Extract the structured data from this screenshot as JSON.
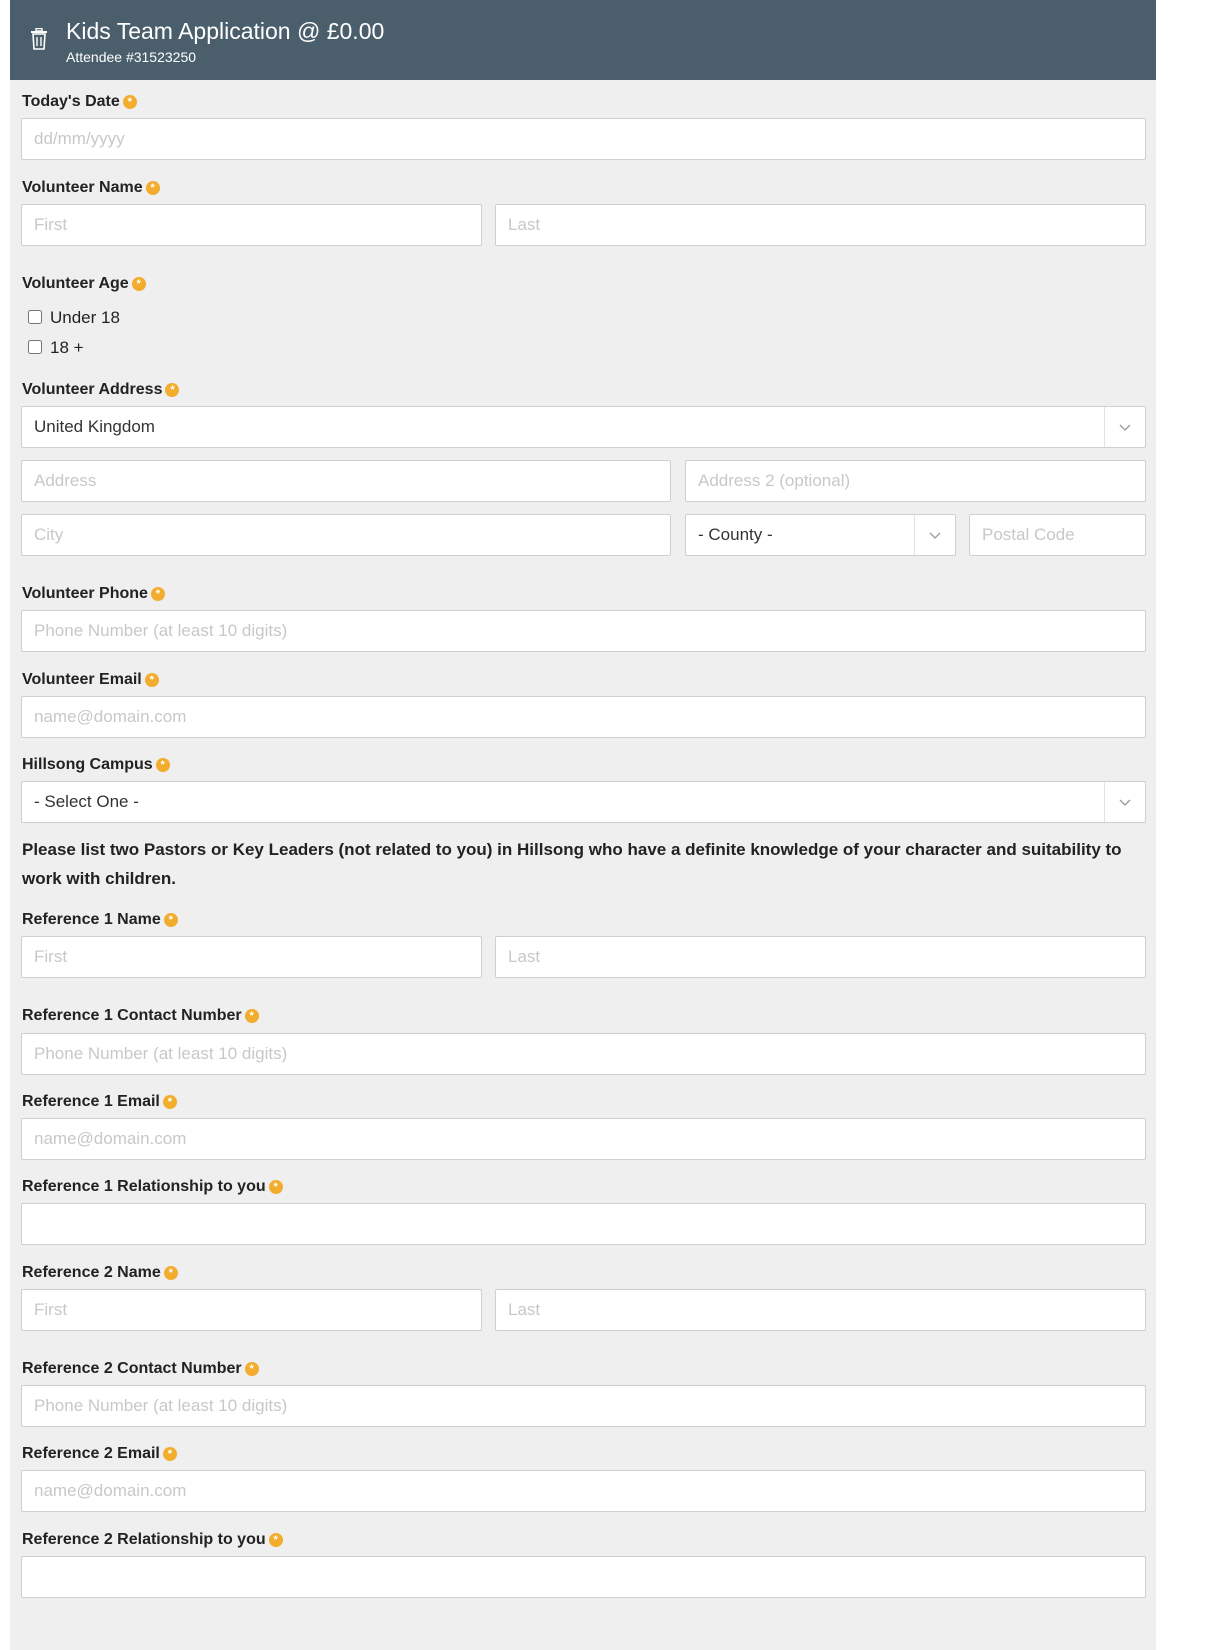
{
  "header": {
    "title": "Kids Team Application @ £0.00",
    "attendee": "Attendee #31523250"
  },
  "required_marker": "*",
  "todays_date": {
    "label": "Today's Date",
    "placeholder": "dd/mm/yyyy"
  },
  "volunteer_name": {
    "label": "Volunteer Name",
    "first_placeholder": "First",
    "last_placeholder": "Last"
  },
  "volunteer_age": {
    "label": "Volunteer Age",
    "options": [
      "Under 18",
      "18 +"
    ]
  },
  "volunteer_address": {
    "label": "Volunteer Address",
    "country": "United Kingdom",
    "address_placeholder": "Address",
    "address2_placeholder": "Address 2 (optional)",
    "city_placeholder": "City",
    "county": "- County -",
    "postal_placeholder": "Postal Code"
  },
  "volunteer_phone": {
    "label": "Volunteer Phone",
    "placeholder": "Phone Number (at least 10 digits)"
  },
  "volunteer_email": {
    "label": "Volunteer Email",
    "placeholder": "name@domain.com"
  },
  "campus": {
    "label": "Hillsong Campus",
    "value": "- Select One -"
  },
  "references_note": "Please list two Pastors or Key Leaders (not related to you) in Hillsong who have a definite knowledge of your character and suitability to work with children.",
  "ref1": {
    "name_label": "Reference 1 Name",
    "first_placeholder": "First",
    "last_placeholder": "Last",
    "contact_label": "Reference 1 Contact Number",
    "contact_placeholder": "Phone Number (at least 10 digits)",
    "email_label": "Reference 1 Email",
    "email_placeholder": "name@domain.com",
    "relationship_label": "Reference 1 Relationship to you"
  },
  "ref2": {
    "name_label": "Reference 2 Name",
    "first_placeholder": "First",
    "last_placeholder": "Last",
    "contact_label": "Reference 2 Contact Number",
    "contact_placeholder": "Phone Number (at least 10 digits)",
    "email_label": "Reference 2 Email",
    "email_placeholder": "name@domain.com",
    "relationship_label": "Reference 2 Relationship to you"
  },
  "colors": {
    "header_bg": "#4a5f6b",
    "panel_bg": "#efefef",
    "required_badge": "#f2ad2f"
  },
  "icons": {
    "remove": "trash-icon",
    "dropdown": "chevron-down-icon"
  }
}
